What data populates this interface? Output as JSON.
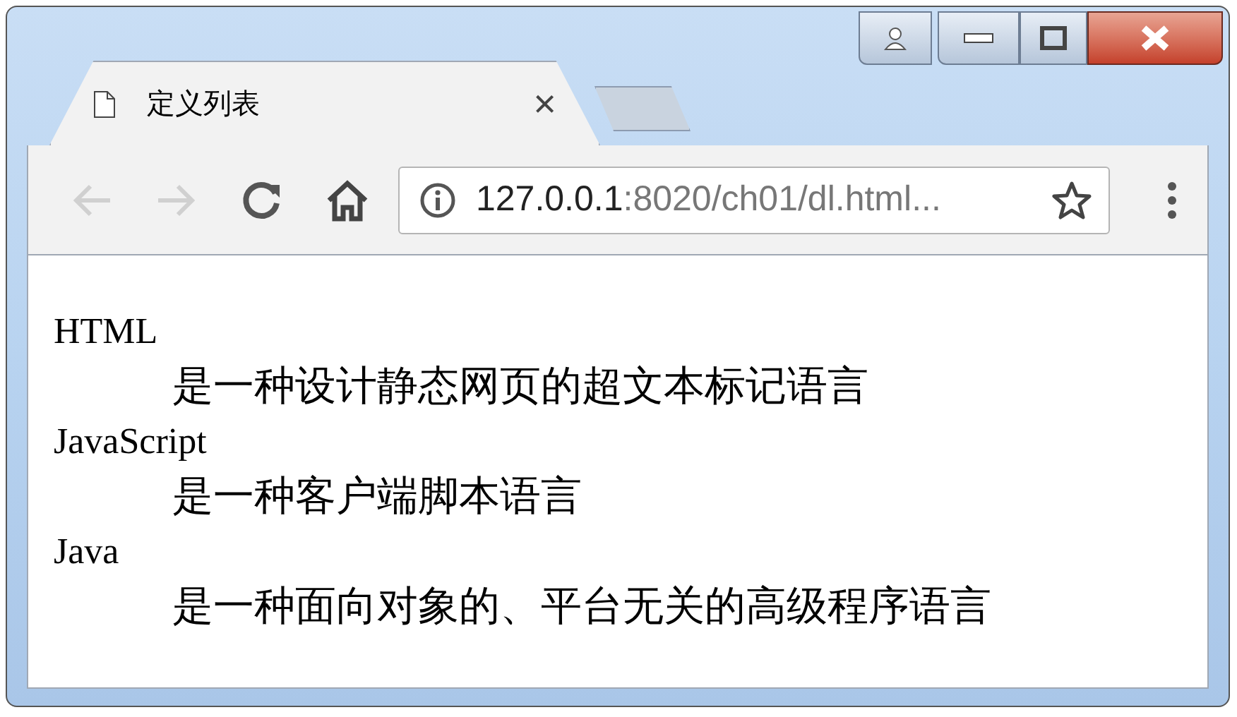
{
  "tab": {
    "title": "定义列表",
    "close": "×"
  },
  "address": {
    "host": "127.0.0.1",
    "rest": ":8020/ch01/dl.html..."
  },
  "toolbar": {
    "back_disabled": true,
    "forward_disabled": true
  },
  "definition_list": [
    {
      "term": "HTML",
      "description": "是一种设计静态网页的超文本标记语言"
    },
    {
      "term": "JavaScript",
      "description": "是一种客户端脚本语言"
    },
    {
      "term": "Java",
      "description": "是一种面向对象的、平台无关的高级程序语言"
    }
  ]
}
